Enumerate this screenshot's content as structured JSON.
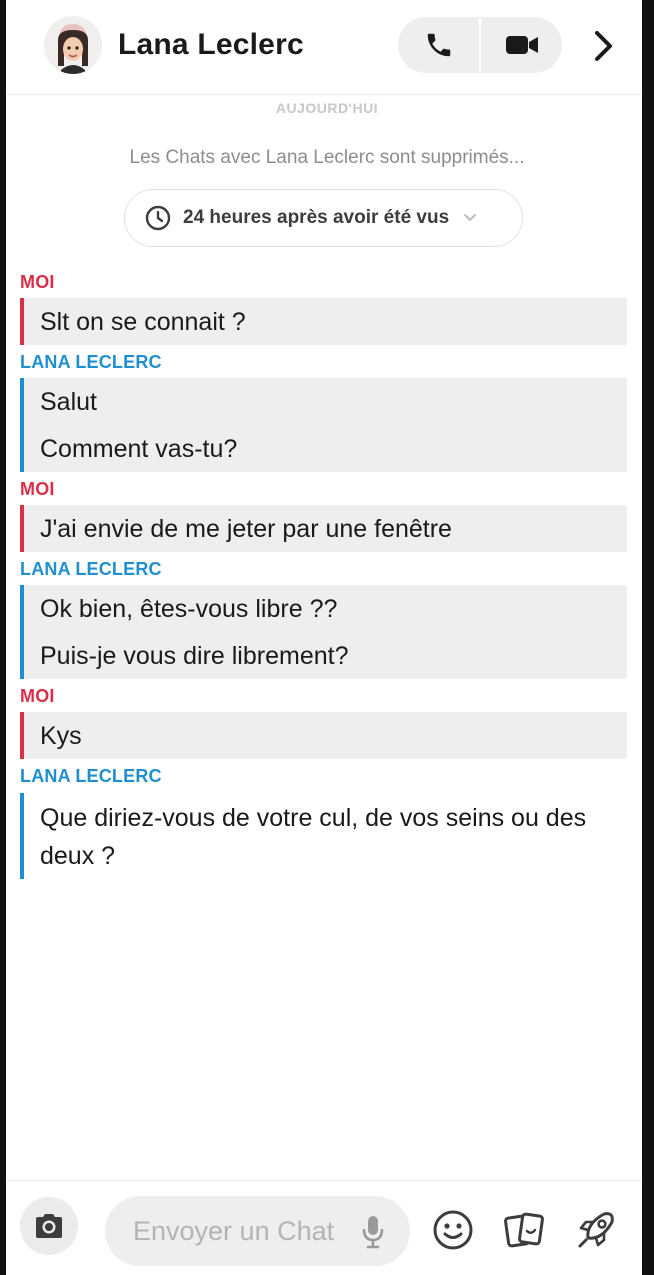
{
  "header": {
    "contact_name": "Lana Leclerc",
    "avatar_icon": "bitmoji-avatar",
    "actions": [
      {
        "name": "voice-call",
        "icon": "phone-icon"
      },
      {
        "name": "video-call",
        "icon": "video-camera-icon"
      },
      {
        "name": "open-profile",
        "icon": "chevron-right-icon"
      }
    ]
  },
  "chat": {
    "date_label": "AUJOURD'HUI",
    "notice": "Les Chats avec Lana Leclerc sont supprimés...",
    "timer": {
      "label": "24 heures après avoir été vus",
      "icon": "clock-icon",
      "dropdown_icon": "chevron-down-icon"
    },
    "messages": [
      {
        "sender": "MOI",
        "from": "me",
        "lines": [
          "Slt on se connait ?"
        ]
      },
      {
        "sender": "LANA LECLERC",
        "from": "them",
        "lines": [
          "Salut",
          "Comment vas-tu?"
        ]
      },
      {
        "sender": "MOI",
        "from": "me",
        "lines": [
          "J'ai envie de me jeter par une fenêtre"
        ]
      },
      {
        "sender": "LANA LECLERC",
        "from": "them",
        "lines": [
          "Ok bien, êtes-vous libre ??",
          "Puis-je vous dire librement?"
        ]
      },
      {
        "sender": "MOI",
        "from": "me",
        "lines": [
          "Kys"
        ]
      },
      {
        "sender": "LANA LECLERC",
        "from": "them",
        "text": "Que diriez-vous de votre cul, de vos seins ou des deux ?"
      }
    ]
  },
  "composer": {
    "placeholder": "Envoyer un Chat",
    "value": "",
    "icons": [
      "camera-icon",
      "microphone-icon",
      "smiley-icon",
      "sticker-cards-icon",
      "rocket-icon"
    ]
  },
  "colors": {
    "me_accent": "#d9304a",
    "them_accent": "#1f8fd1",
    "bubble_bg": "#eeeeee"
  }
}
